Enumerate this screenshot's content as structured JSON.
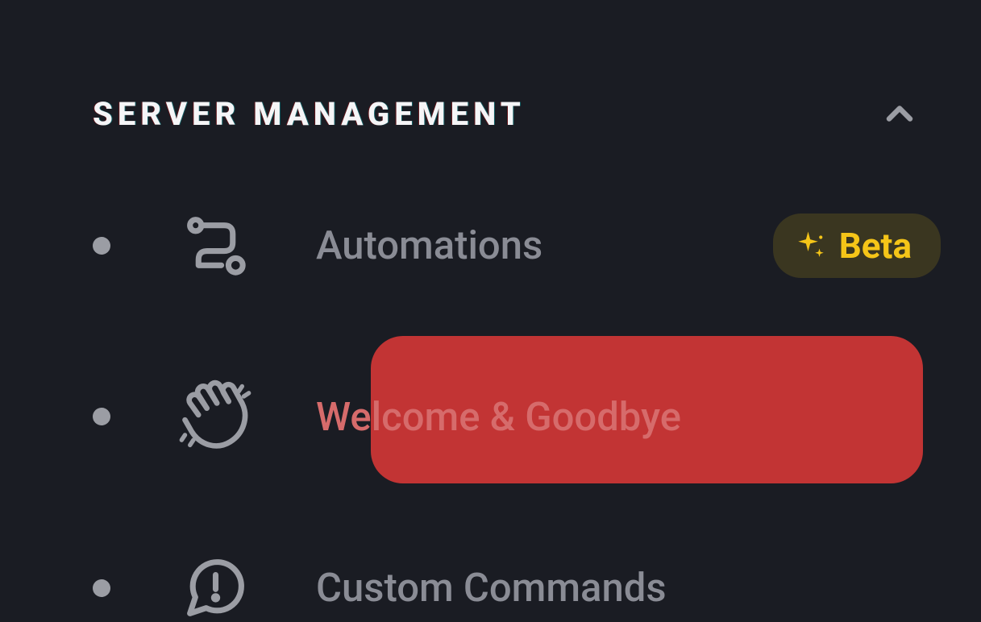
{
  "section": {
    "title": "SERVER MANAGEMENT"
  },
  "nav": {
    "items": [
      {
        "label": "Automations",
        "badge": "Beta"
      },
      {
        "label": "Welcome & Goodbye"
      },
      {
        "label": "Custom Commands"
      }
    ]
  }
}
